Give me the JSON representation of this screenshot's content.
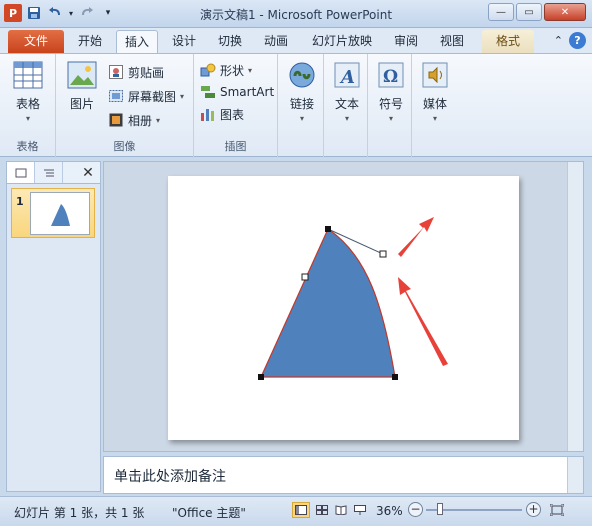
{
  "title_bar": {
    "app_icon_letter": "P",
    "title": "演示文稿1 - Microsoft PowerPoint",
    "quick_access": [
      "save-icon",
      "undo-icon",
      "redo-icon",
      "customize-icon"
    ],
    "controls": [
      "minimize",
      "maximize",
      "close"
    ]
  },
  "tabs": [
    {
      "label": "文件"
    },
    {
      "label": "开始"
    },
    {
      "label": "插入"
    },
    {
      "label": "设计"
    },
    {
      "label": "切换"
    },
    {
      "label": "动画"
    },
    {
      "label": "幻灯片放映"
    },
    {
      "label": "审阅"
    },
    {
      "label": "视图"
    },
    {
      "label": "格式"
    }
  ],
  "active_tab": "插入",
  "ribbon": {
    "table_group": {
      "button": "表格",
      "label": "表格"
    },
    "image_group": {
      "picture": "图片",
      "clipart": "剪贴画",
      "screenshot": "屏幕截图",
      "album": "相册",
      "label": "图像"
    },
    "illustration_group": {
      "shapes": "形状",
      "smartart": "SmartArt",
      "chart": "图表",
      "label": "插图"
    },
    "link": "链接",
    "text": "文本",
    "symbol": "符号",
    "media": "媒体"
  },
  "slide_panel": {
    "slide_number": "1"
  },
  "notes_placeholder": "单击此处添加备注",
  "status": {
    "slide_info": "幻灯片 第 1 张，共 1 张",
    "theme": "\"Office 主题\"",
    "zoom": "36%",
    "zoom_fraction": 0.36
  },
  "colors": {
    "shape_fill": "#4f81bd",
    "shape_outline": "#c0392b",
    "arrow_red": "#e8413a",
    "file_tab": "#d24726"
  }
}
